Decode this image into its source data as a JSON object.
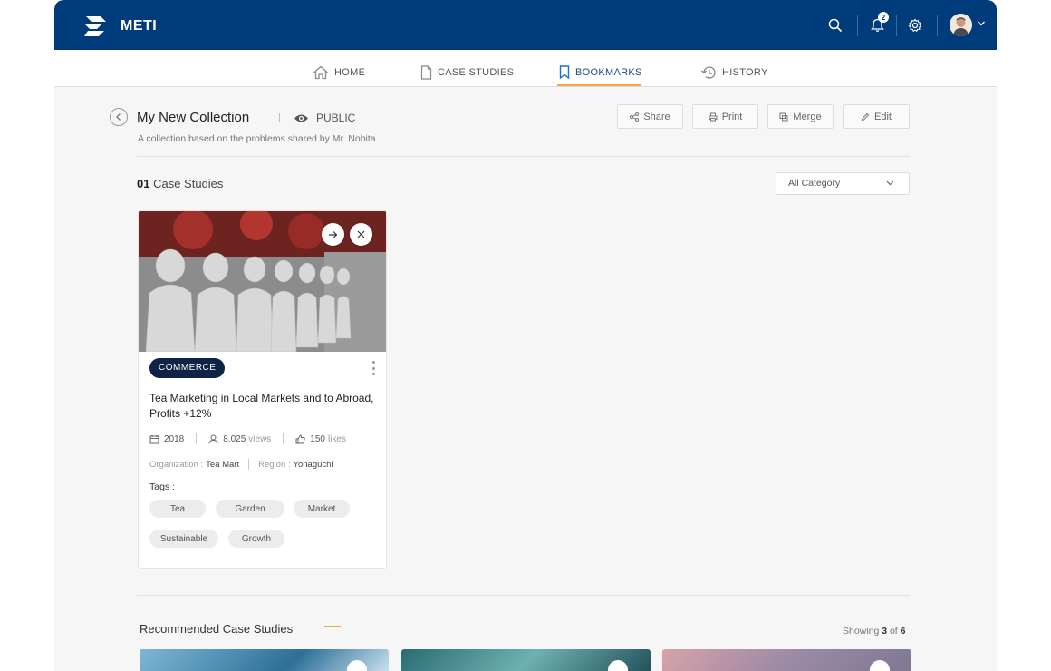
{
  "header": {
    "brand": "METI",
    "notification_count": "2",
    "colors": {
      "primary": "#003b7c",
      "accent": "#f2a93b"
    },
    "icons": [
      "search-icon",
      "bell-icon",
      "gear-icon",
      "chevron-down-icon"
    ]
  },
  "nav": {
    "items": [
      {
        "label": "HOME",
        "icon": "home-icon"
      },
      {
        "label": "CASE STUDIES",
        "icon": "document-icon"
      },
      {
        "label": "BOOKMARKS",
        "icon": "bookmark-icon",
        "active": true
      },
      {
        "label": "HISTORY",
        "icon": "history-icon"
      }
    ]
  },
  "collection": {
    "title": "My New Collection",
    "visibility": "PUBLIC",
    "description": "A collection based on the problems shared by Mr. Nobita",
    "actions": {
      "share": "Share",
      "print": "Print",
      "merge": "Merge",
      "edit": "Edit"
    }
  },
  "list": {
    "count": "01",
    "count_label": "Case Studies",
    "category_filter": "All Category"
  },
  "card": {
    "category": "COMMERCE",
    "title": "Tea Marketing in Local Markets and to Abroad, Profits +12%",
    "year": "2018",
    "views": "8,025",
    "views_label": "views",
    "likes": "150",
    "likes_label": "likes",
    "org_label": "Organization :",
    "org": "Tea Mart",
    "region_label": "Region :",
    "region": "Yonaguchi",
    "tags_label": "Tags :",
    "tags": [
      "Tea",
      "Garden",
      "Market",
      "Sustainable",
      "Growth"
    ]
  },
  "recommended": {
    "title": "Recommended Case Studies",
    "showing_prefix": "Showing",
    "showing_current": "3",
    "showing_of": "of",
    "showing_total": "6"
  }
}
